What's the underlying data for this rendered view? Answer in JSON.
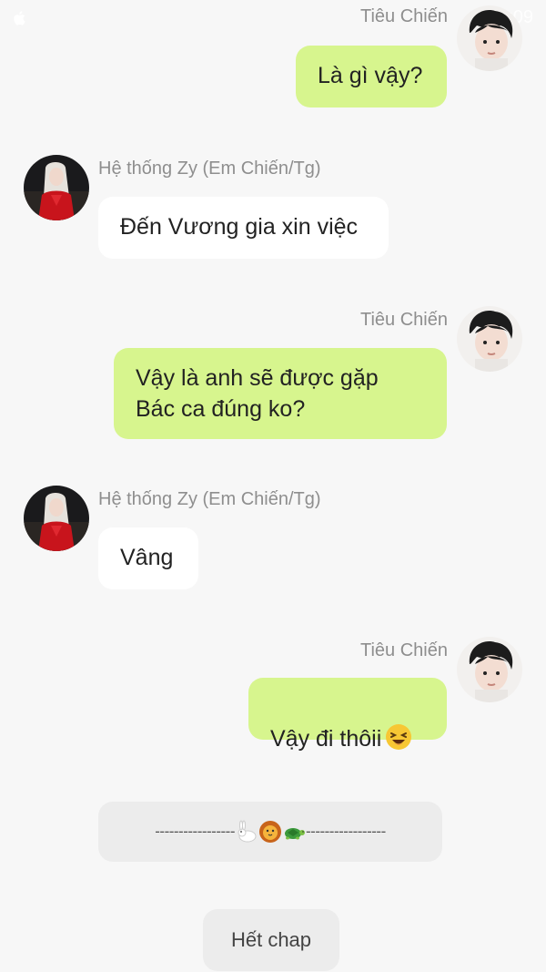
{
  "status_bar": {
    "time": "10:09"
  },
  "users": {
    "me": "Tiêu Chiến",
    "system": "Hệ thống Zy (Em Chiến/Tg)"
  },
  "messages": [
    {
      "sender": "Tiêu Chiến",
      "side": "right",
      "text": "Là gì vậy?"
    },
    {
      "sender": "Hệ thống Zy (Em Chiến/Tg)",
      "side": "left",
      "text": "Đến Vương gia xin việc"
    },
    {
      "sender": "Tiêu Chiến",
      "side": "right",
      "text": "Vậy là anh sẽ được gặp\nBác ca đúng ko?"
    },
    {
      "sender": "Hệ thống Zy (Em Chiến/Tg)",
      "side": "left",
      "text": "Vâng"
    },
    {
      "sender": "Tiêu Chiến",
      "side": "right",
      "text": "Vậy đi thôii"
    }
  ],
  "separator": {
    "left_dashes": "-----------------",
    "right_dashes": "-----------------",
    "emojis": [
      "rabbit-emoji",
      "lion-emoji",
      "turtle-emoji"
    ]
  },
  "end_button": {
    "label": "Hết chap"
  },
  "colors": {
    "background": "#f7f7f7",
    "sent_bubble": "#d7f58e",
    "received_bubble": "#ffffff",
    "name_text": "#8e8e8e",
    "separator_bg": "#ececec"
  }
}
